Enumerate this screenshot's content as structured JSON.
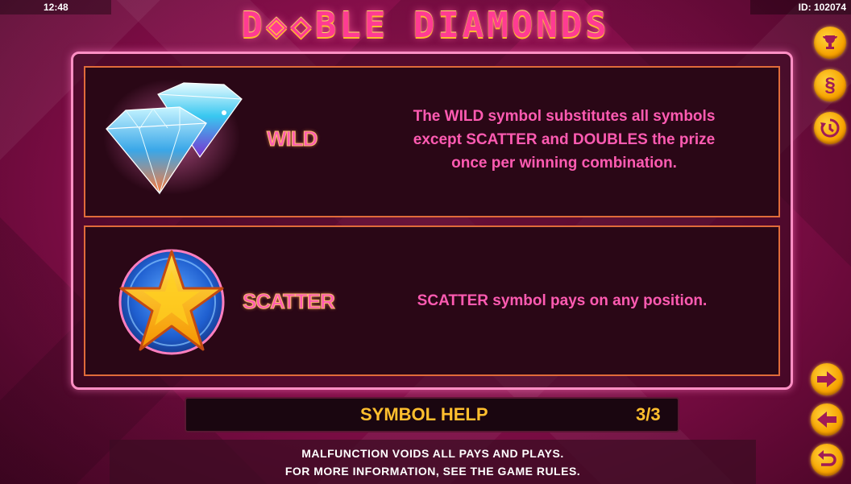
{
  "status": {
    "time": "12:48",
    "id": "ID: 102074"
  },
  "logo": {
    "text": "D◈◇BLE DIAMONDS"
  },
  "symbols": [
    {
      "name": "WILD",
      "description_lines": [
        "The WILD symbol substitutes all symbols",
        "except SCATTER and DOUBLES the prize",
        "once per winning combination."
      ],
      "icon": "diamond-icon"
    },
    {
      "name": "SCATTER",
      "description_lines": [
        "SCATTER symbol pays on any position."
      ],
      "icon": "star-icon"
    }
  ],
  "footer": {
    "title": "SYMBOL HELP",
    "page": "3/3"
  },
  "disclaimer": {
    "line1": "MALFUNCTION VOIDS ALL PAYS AND PLAYS.",
    "line2": "FOR MORE INFORMATION, SEE THE GAME RULES."
  },
  "side_buttons": {
    "top": [
      {
        "icon": "trophy-icon"
      },
      {
        "icon": "paragraph-icon",
        "label": "§"
      },
      {
        "icon": "history-icon"
      }
    ],
    "bottom": [
      {
        "icon": "arrow-right-icon"
      },
      {
        "icon": "arrow-left-icon"
      },
      {
        "icon": "return-icon"
      }
    ]
  },
  "colors": {
    "accent": "#ff5bb2",
    "gold": "#ffbf2e",
    "border": "#e06b3a"
  }
}
